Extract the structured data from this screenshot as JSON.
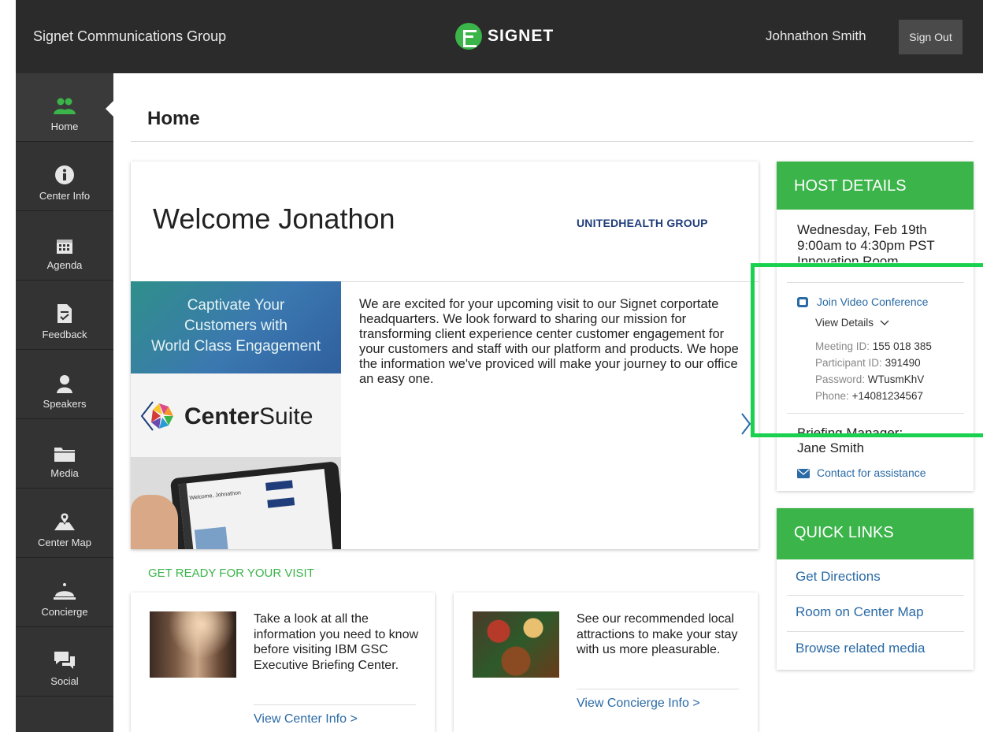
{
  "header": {
    "org_name": "Signet Communications Group",
    "logo_text": "SIGNET",
    "user_name": "Johnathon Smith",
    "sign_out_label": "Sign Out"
  },
  "sidebar": {
    "items": [
      {
        "label": "Home",
        "icon": "people-icon",
        "active": true
      },
      {
        "label": "Center Info",
        "icon": "info-icon"
      },
      {
        "label": "Agenda",
        "icon": "calendar-icon"
      },
      {
        "label": "Feedback",
        "icon": "clipboard-icon"
      },
      {
        "label": "Speakers",
        "icon": "person-icon"
      },
      {
        "label": "Media",
        "icon": "folder-icon"
      },
      {
        "label": "Center Map",
        "icon": "map-icon"
      },
      {
        "label": "Concierge",
        "icon": "bell-icon"
      },
      {
        "label": "Social",
        "icon": "chat-icon"
      }
    ]
  },
  "page": {
    "title": "Home"
  },
  "welcome": {
    "title": "Welcome Jonathon",
    "client_logo": "UNITEDHEALTH GROUP",
    "promo_lines": [
      "Captivate Your",
      "Customers with",
      "World Class Engagement"
    ],
    "promo_brand_bold": "Center",
    "promo_brand_rest": "Suite",
    "tablet_title": "Welcome, Johnathon",
    "body": "We are excited for your upcoming visit to our Signet corportate headquarters. We look forward to sharing our mission for transforming client experience center customer engagement for your customers and staff with our platform and products. We hope the information we've proviced will make your journey to our office an easy one."
  },
  "get_ready": {
    "heading": "GET READY FOR YOUR VISIT",
    "cards": [
      {
        "text": "Take a look at all the information you need to know before visiting IBM GSC Executive Briefing Center.",
        "link": "View Center Info >"
      },
      {
        "text": "See our recommended local attractions to make your stay with us more pleasurable.",
        "link": "View Concierge Info >"
      }
    ]
  },
  "host_details": {
    "heading": "HOST DETAILS",
    "date": "Wednesday, Feb 19th",
    "time": "9:00am to 4:30pm PST",
    "room": "Innovation Room",
    "video_link": "Join Video Conference",
    "view_details": "View Details",
    "meeting_id_label": "Meeting ID:",
    "meeting_id": "155 018 385",
    "participant_id_label": "Participant ID:",
    "participant_id": "391490",
    "password_label": "Password:",
    "password": "WTusmKhV",
    "phone_label": "Phone:",
    "phone": "+14081234567",
    "briefing_manager_label": "Briefing Manager:",
    "briefing_manager": "Jane Smith",
    "contact_link": "Contact for assistance"
  },
  "quick_links": {
    "heading": "QUICK LINKS",
    "items": [
      "Get Directions",
      "Room on Center Map",
      "Browse related media"
    ]
  },
  "colors": {
    "accent_green": "#3bb44a",
    "link_blue": "#2a6aa6",
    "highlight_green": "#19d04f",
    "topbar": "#2b2b2b"
  }
}
